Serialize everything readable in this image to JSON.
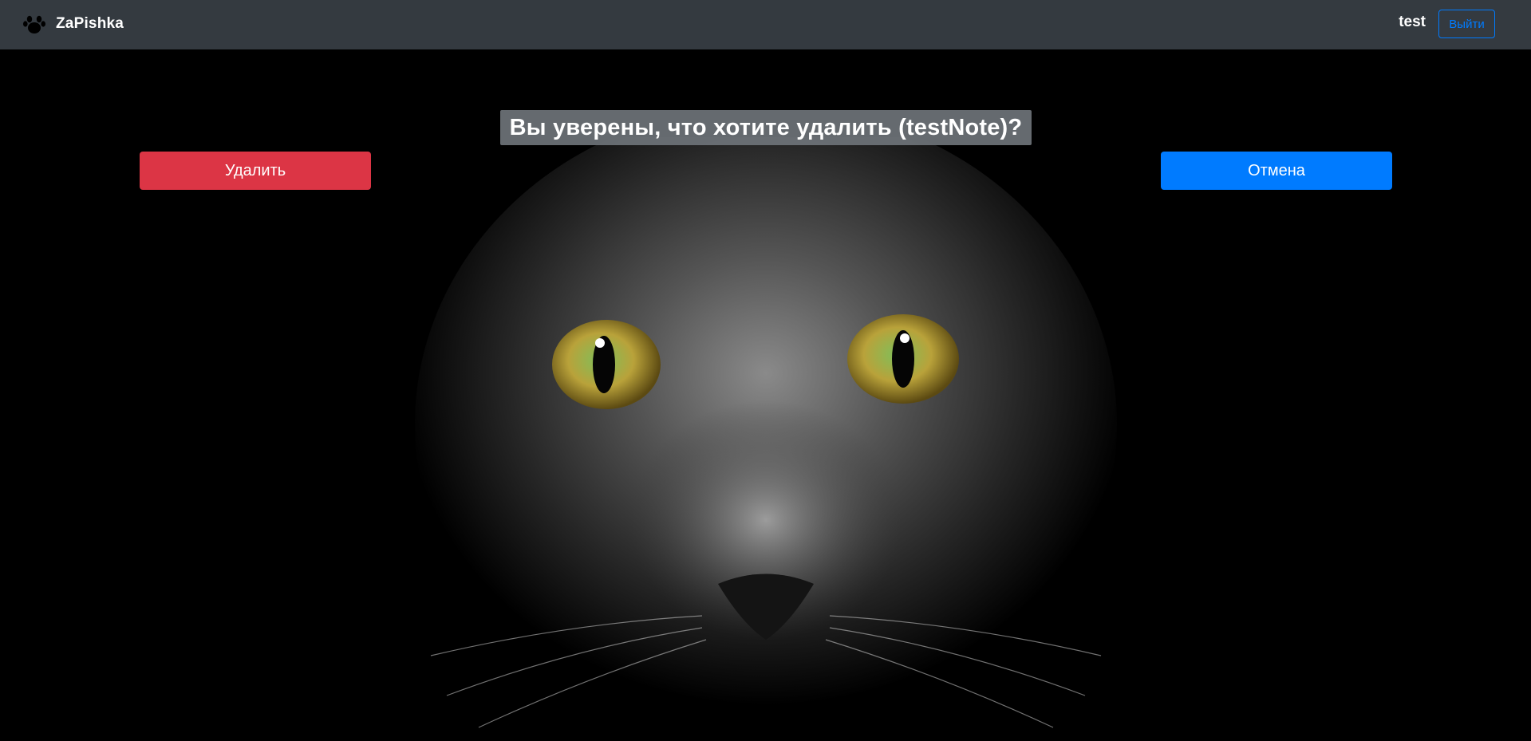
{
  "navbar": {
    "brand": "ZaPishka",
    "brand_icon": "paw-icon",
    "user": "test",
    "logout_label": "Выйти"
  },
  "dialog": {
    "title": "Вы уверены, что хотите удалить (testNote)?",
    "delete_label": "Удалить",
    "cancel_label": "Отмена"
  },
  "background": {
    "image": "black-cat-face-photo"
  },
  "colors": {
    "navbar": "#343a40",
    "danger": "#dc3545",
    "primary": "#007bff",
    "title_bg": "#6e7378"
  }
}
